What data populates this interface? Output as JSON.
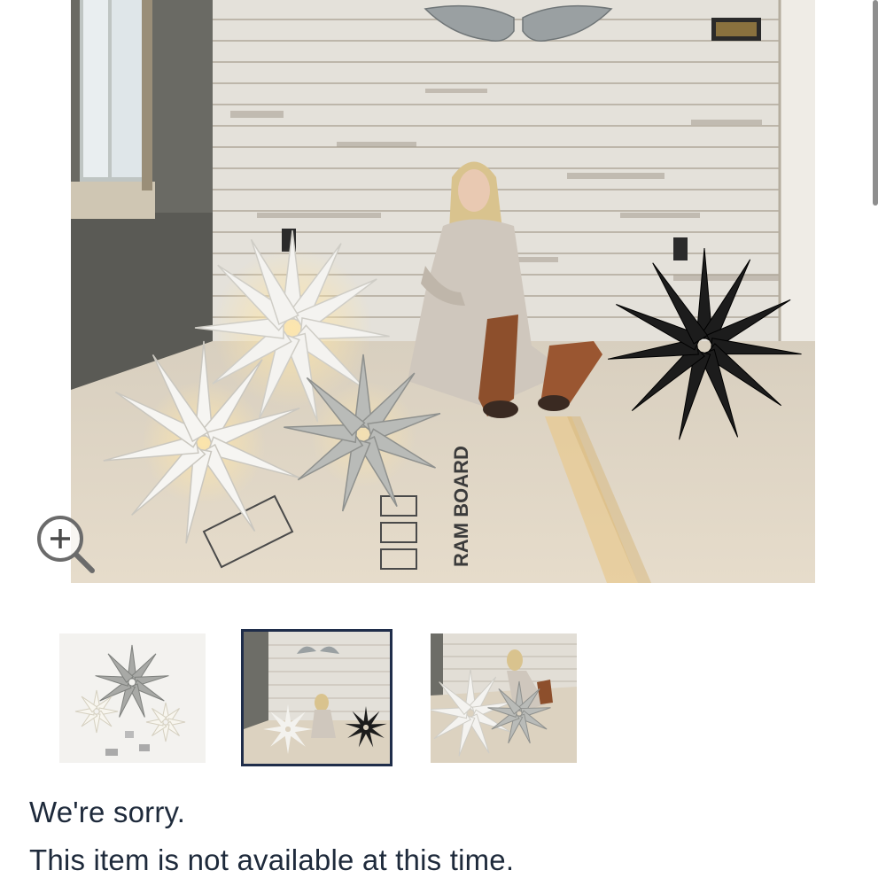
{
  "product_gallery": {
    "main_image_alt": "",
    "zoom_icon": "zoom-in-magnifier-icon",
    "thumbnails": [
      {
        "icon": "thumbnail-stars-white-background",
        "selected": false
      },
      {
        "icon": "thumbnail-woman-with-stars",
        "selected": true
      },
      {
        "icon": "thumbnail-stars-close-up",
        "selected": false
      }
    ],
    "selected_border_color": "#1f2d4a"
  },
  "availability": {
    "heading": "We're sorry.",
    "message": "This item is not available at this time.",
    "text_color": "#1e2a3b"
  },
  "floor_print": {
    "brand_text": "RAM BOARD"
  }
}
